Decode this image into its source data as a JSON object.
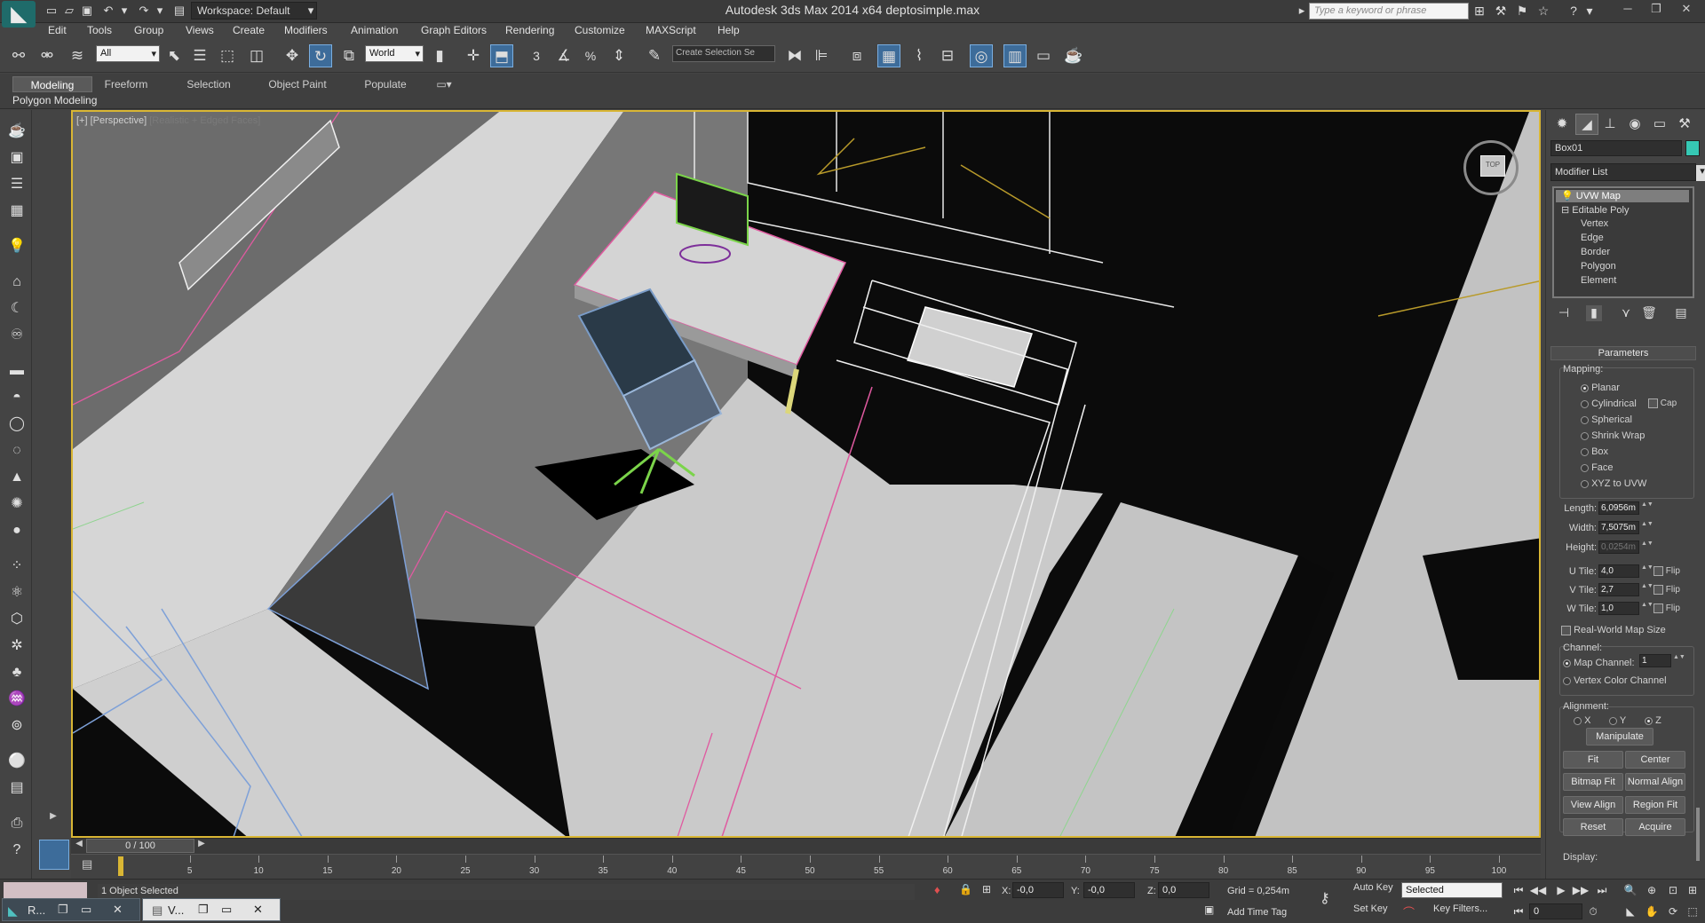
{
  "window": {
    "title": "Autodesk 3ds Max  2014 x64     deptosimple.max",
    "workspace": "Workspace: Default",
    "search_placeholder": "Type a keyword or phrase"
  },
  "menu": [
    "Edit",
    "Tools",
    "Group",
    "Views",
    "Create",
    "Modifiers",
    "Animation",
    "Graph Editors",
    "Rendering",
    "Customize",
    "MAXScript",
    "Help"
  ],
  "toolbar": {
    "selection_filter": "All",
    "ref_coord": "World",
    "snap_3d": "3",
    "snap_percent": "%",
    "named_selection": "Create Selection Se"
  },
  "ribbon": {
    "tabs": [
      "Modeling",
      "Freeform",
      "Selection",
      "Object Paint",
      "Populate"
    ],
    "panel_label": "Polygon Modeling"
  },
  "viewport": {
    "label": "[+] [Perspective]",
    "mode": "[Realistic + Edged Faces]",
    "viewcube_face": "TOP"
  },
  "command_panel": {
    "object_name": "Box01",
    "object_color": "#36c8b4",
    "modifier_list": "Modifier List",
    "stack": [
      {
        "label": "UVW Map",
        "level": 0,
        "selected": true
      },
      {
        "label": "Editable Poly",
        "level": 0,
        "selected": false
      },
      {
        "label": "Vertex",
        "level": 1,
        "selected": false
      },
      {
        "label": "Edge",
        "level": 1,
        "selected": false
      },
      {
        "label": "Border",
        "level": 1,
        "selected": false
      },
      {
        "label": "Polygon",
        "level": 1,
        "selected": false
      },
      {
        "label": "Element",
        "level": 1,
        "selected": false
      }
    ],
    "rollout": "Parameters",
    "mapping": {
      "label": "Mapping:",
      "options": [
        "Planar",
        "Cylindrical",
        "Spherical",
        "Shrink Wrap",
        "Box",
        "Face",
        "XYZ to UVW"
      ],
      "selected": "Planar",
      "cap_label": "Cap"
    },
    "params": [
      {
        "label": "Length:",
        "value": "6,0956m",
        "dim": false
      },
      {
        "label": "Width:",
        "value": "7,5075m",
        "dim": false
      },
      {
        "label": "Height:",
        "value": "0,0254m",
        "dim": true
      }
    ],
    "tiles": [
      {
        "label": "U Tile:",
        "value": "4,0",
        "flip": "Flip"
      },
      {
        "label": "V Tile:",
        "value": "2,7",
        "flip": "Flip"
      },
      {
        "label": "W Tile:",
        "value": "1,0",
        "flip": "Flip"
      }
    ],
    "real_world": "Real-World Map Size",
    "channel": {
      "label": "Channel:",
      "map_channel": "Map Channel:",
      "map_channel_value": "1",
      "vertex_color": "Vertex Color Channel"
    },
    "alignment": {
      "label": "Alignment:",
      "axes": [
        "X",
        "Y",
        "Z"
      ],
      "selected": "Z",
      "manipulate": "Manipulate",
      "buttons": [
        "Fit",
        "Center",
        "Bitmap Fit",
        "Normal Align",
        "View Align",
        "Region Fit",
        "Reset",
        "Acquire"
      ]
    },
    "display_label": "Display:"
  },
  "timeline": {
    "position": "0 / 100",
    "ticks": [
      5,
      10,
      15,
      20,
      25,
      30,
      35,
      40,
      45,
      50,
      55,
      60,
      65,
      70,
      75,
      80,
      85,
      90,
      95,
      100
    ]
  },
  "status": {
    "selection": "1 Object Selected",
    "x_label": "X:",
    "x_value": "-0,0",
    "y_label": "Y:",
    "y_value": "-0,0",
    "z_label": "Z:",
    "z_value": "0,0",
    "grid": "Grid = 0,254m",
    "add_time_tag": "Add Time Tag",
    "auto_key": "Auto Key",
    "set_key": "Set Key",
    "key_mode": "Selected",
    "key_filters": "Key Filters...",
    "frame": "0"
  },
  "taskbar": [
    {
      "label": "R..."
    },
    {
      "label": "V..."
    }
  ]
}
